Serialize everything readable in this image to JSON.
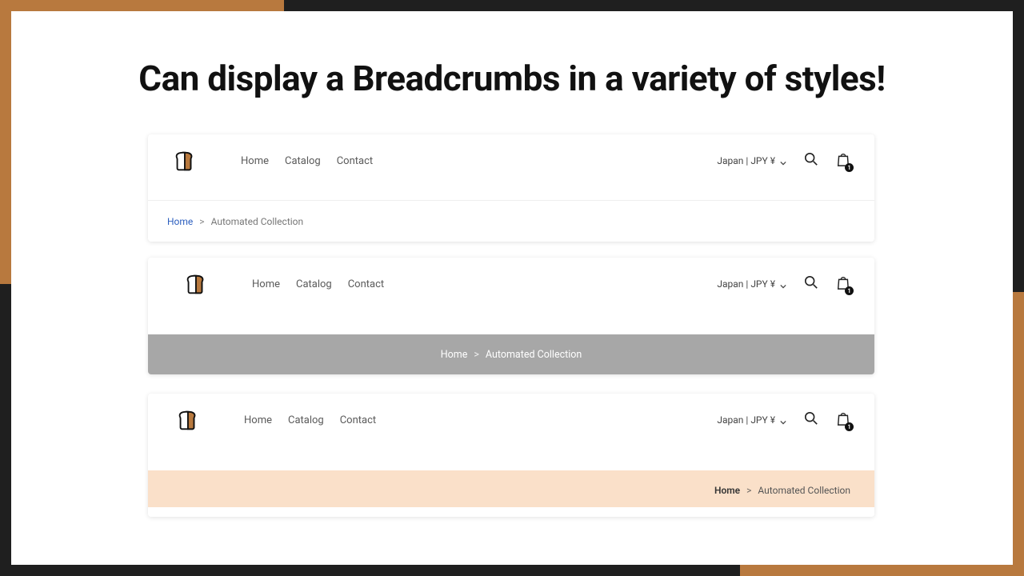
{
  "heading": "Can display a Breadcrumbs in a variety of styles!",
  "nav": {
    "links": [
      "Home",
      "Catalog",
      "Contact"
    ],
    "locale": "Japan | JPY ¥",
    "cart_count": "1"
  },
  "breadcrumb": {
    "home": "Home",
    "sep": ">",
    "current": "Automated Collection"
  }
}
